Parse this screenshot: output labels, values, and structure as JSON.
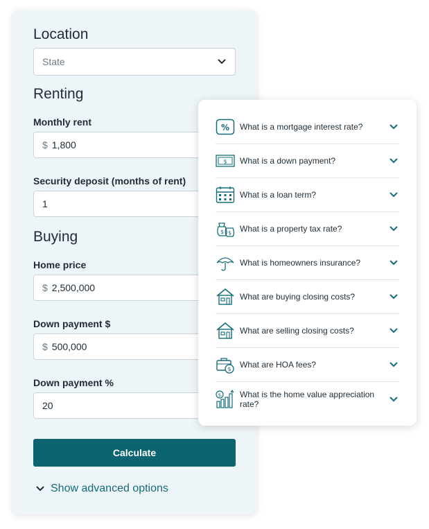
{
  "form": {
    "location_title": "Location",
    "state_placeholder": "State",
    "renting_title": "Renting",
    "monthly_rent_label": "Monthly rent",
    "monthly_rent_prefix": "$",
    "monthly_rent_value": "1,800",
    "security_deposit_label": "Security deposit (months of rent)",
    "security_deposit_value": "1",
    "buying_title": "Buying",
    "home_price_label": "Home price",
    "home_price_prefix": "$",
    "home_price_value": "2,500,000",
    "down_payment_label": "Down payment $",
    "down_payment_prefix": "$",
    "down_payment_value": "500,000",
    "down_payment_pct_label": "Down payment %",
    "down_payment_pct_value": "20",
    "calculate_label": "Calculate",
    "advanced_label": "Show advanced options"
  },
  "faq": {
    "items": [
      {
        "icon": "percent-icon",
        "text": "What is a mortgage interest rate?"
      },
      {
        "icon": "cash-bill-icon",
        "text": "What is a down payment?"
      },
      {
        "icon": "calendar-icon",
        "text": "What is a loan term?"
      },
      {
        "icon": "money-bags-icon",
        "text": "What is a property tax rate?"
      },
      {
        "icon": "umbrella-icon",
        "text": "What is homeowners insurance?"
      },
      {
        "icon": "house-icon",
        "text": "What are buying closing costs?"
      },
      {
        "icon": "house-icon",
        "text": "What are selling closing costs?"
      },
      {
        "icon": "briefcase-coin-icon",
        "text": "What are HOA fees?"
      },
      {
        "icon": "bar-chart-dollar-icon",
        "text": "What is the home value appreciation rate?"
      }
    ]
  },
  "colors": {
    "accent": "#0b6470",
    "icon": "#156c78",
    "card_bg": "#eef5f8"
  }
}
